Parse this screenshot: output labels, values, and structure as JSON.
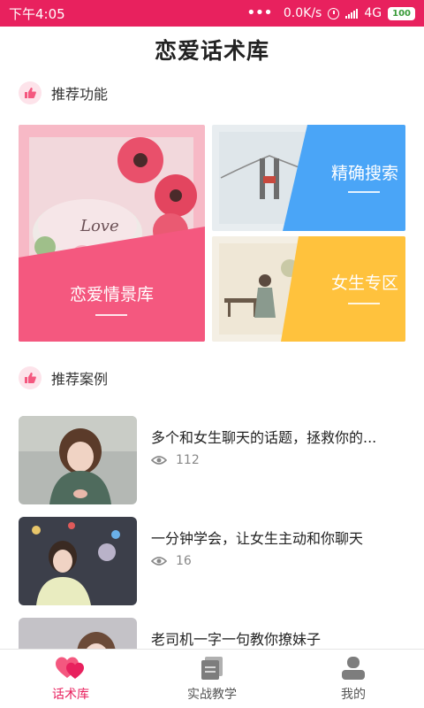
{
  "status_bar": {
    "time": "下午4:05",
    "dots": "•••",
    "speed": "0.0K/s",
    "network": "4G",
    "battery": "100"
  },
  "header": {
    "title": "恋爱话术库"
  },
  "sections": {
    "features": {
      "title": "推荐功能",
      "cards": [
        {
          "label": "恋爱情景库",
          "accent": "#f4587f"
        },
        {
          "label": "精确搜索",
          "accent": "#4aa5f7"
        },
        {
          "label": "女生专区",
          "accent": "#ffc23d"
        }
      ]
    },
    "cases": {
      "title": "推荐案例",
      "items": [
        {
          "title": "多个和女生聊天的话题，拯救你的...",
          "views": "112"
        },
        {
          "title": "一分钟学会，让女生主动和你聊天",
          "views": "16"
        },
        {
          "title": "老司机一字一句教你撩妹子",
          "views": ""
        }
      ]
    }
  },
  "tabs": [
    {
      "label": "话术库",
      "icon": "hearts-icon",
      "active": true
    },
    {
      "label": "实战教学",
      "icon": "book-icon",
      "active": false
    },
    {
      "label": "我的",
      "icon": "user-icon",
      "active": false
    }
  ],
  "colors": {
    "brand": "#e8215e",
    "tab_inactive_icon": "#7d7d7d"
  }
}
